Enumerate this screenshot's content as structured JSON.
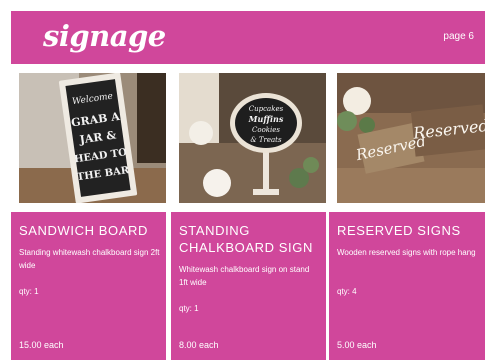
{
  "header": {
    "logo_text": "signage",
    "page_label": "page 6"
  },
  "items": [
    {
      "title": "SANDWICH BOARD",
      "description": "Standing whitewash chalkboard sign 2ft wide",
      "qty": "qty: 1",
      "price": "15.00 each",
      "photo": "sandwich-board-photo"
    },
    {
      "title": "STANDING CHALKBOARD SIGN",
      "description": "Whitewash chalkboard sign on stand 1ft wide",
      "qty": "qty: 1",
      "price": "8.00 each",
      "photo": "standing-chalkboard-photo"
    },
    {
      "title": "RESERVED SIGNS",
      "description": "Wooden reserved signs with rope hang",
      "qty": "qty: 4",
      "price": "5.00 each",
      "photo": "reserved-signs-photo"
    }
  ],
  "photo_text": {
    "welcome_sign": [
      "Welcome",
      "GRAB A",
      "JAR &",
      "HEAD TO",
      "THE BAR"
    ],
    "chalk_sign": [
      "Cupcakes",
      "Muffins",
      "Cookies",
      "& Treats"
    ],
    "reserved": [
      "Reserved",
      "Reserved"
    ]
  },
  "colors": {
    "accent": "#d0479b",
    "text": "#ffffff"
  }
}
